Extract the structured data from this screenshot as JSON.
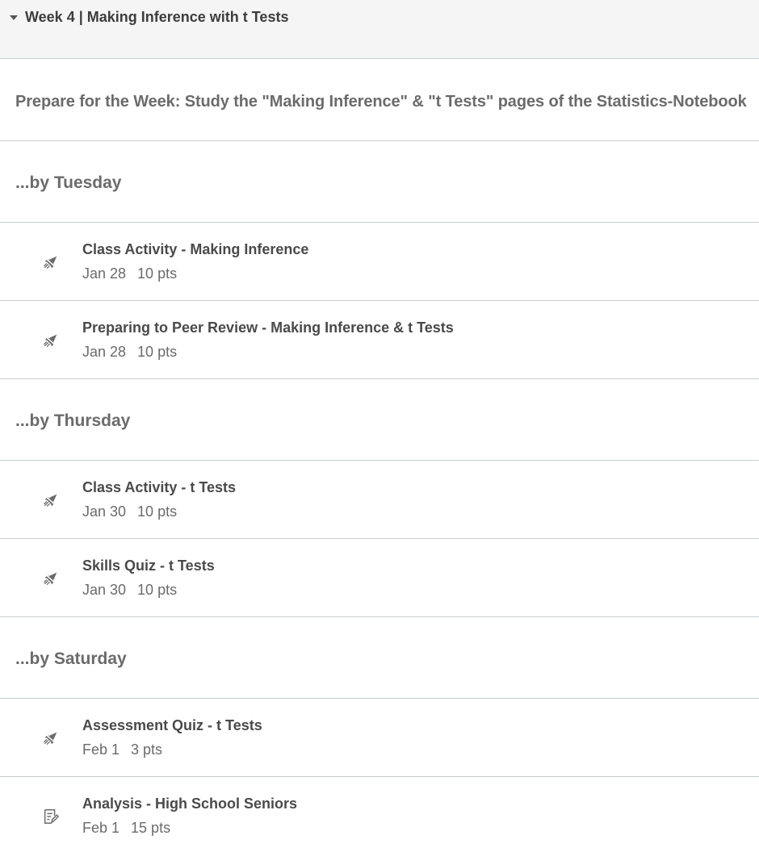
{
  "module": {
    "title": "Week 4 | Making Inference with t Tests"
  },
  "prep": {
    "text": "Prepare for the Week: Study the \"Making Inference\" & \"t Tests\" pages of the Statistics-Notebook"
  },
  "groups": [
    {
      "label": "...by Tuesday",
      "items": [
        {
          "title": "Class Activity - Making Inference",
          "date": "Jan 28",
          "points": "10 pts",
          "icon": "quiz-rocket-icon"
        },
        {
          "title": "Preparing to Peer Review - Making Inference & t Tests",
          "date": "Jan 28",
          "points": "10 pts",
          "icon": "quiz-rocket-icon"
        }
      ]
    },
    {
      "label": "...by Thursday",
      "items": [
        {
          "title": "Class Activity - t Tests",
          "date": "Jan 30",
          "points": "10 pts",
          "icon": "quiz-rocket-icon"
        },
        {
          "title": "Skills Quiz - t Tests",
          "date": "Jan 30",
          "points": "10 pts",
          "icon": "quiz-rocket-icon"
        }
      ]
    },
    {
      "label": "...by Saturday",
      "items": [
        {
          "title": "Assessment Quiz - t Tests",
          "date": "Feb 1",
          "points": "3 pts",
          "icon": "quiz-rocket-icon"
        },
        {
          "title": "Analysis - High School Seniors",
          "date": "Feb 1",
          "points": "15 pts",
          "icon": "assignment-edit-icon"
        }
      ]
    }
  ]
}
